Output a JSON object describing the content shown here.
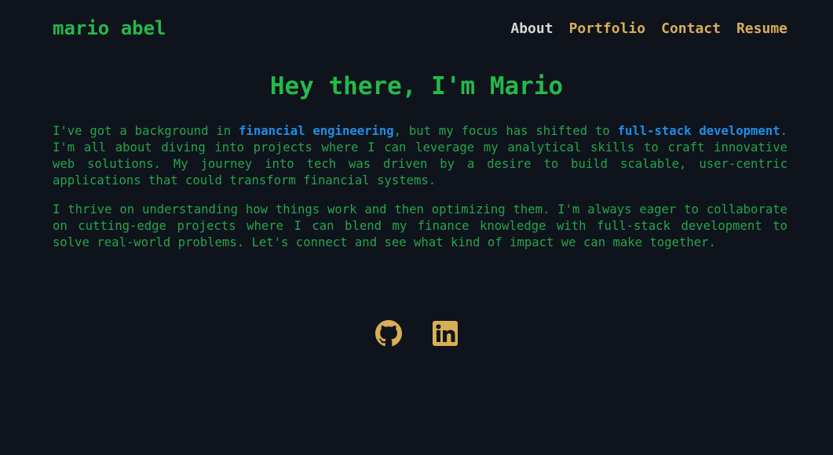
{
  "header": {
    "brand": "mario abel",
    "nav": [
      {
        "label": "About",
        "active": true
      },
      {
        "label": "Portfolio",
        "active": false
      },
      {
        "label": "Contact",
        "active": false
      },
      {
        "label": "Resume",
        "active": false
      }
    ]
  },
  "main": {
    "title": "Hey there, I'm Mario",
    "p1": {
      "t1": "I've got a background in ",
      "h1": "financial engineering",
      "t2": ", but my focus has shifted to ",
      "h2": "full-stack development",
      "t3": ". I'm all about diving into projects where I can leverage my analytical skills to craft innovative web solutions. My journey into tech was driven by a desire to build scalable, user-centric applications that could transform financial systems."
    },
    "p2": "I thrive on understanding how things work and then optimizing them. I'm always eager to collaborate on cutting-edge projects where I can blend my finance knowledge with full-stack development to solve real-world problems. Let's connect and see what kind of impact we can make together."
  },
  "social": [
    {
      "icon": "github-icon"
    },
    {
      "icon": "linkedin-icon"
    }
  ],
  "colors": {
    "background": "#0f131c",
    "text_green": "#25a54a",
    "highlight_blue": "#1e8ee6",
    "nav_gold": "#d8ae56",
    "nav_active": "#d8d8d8"
  }
}
